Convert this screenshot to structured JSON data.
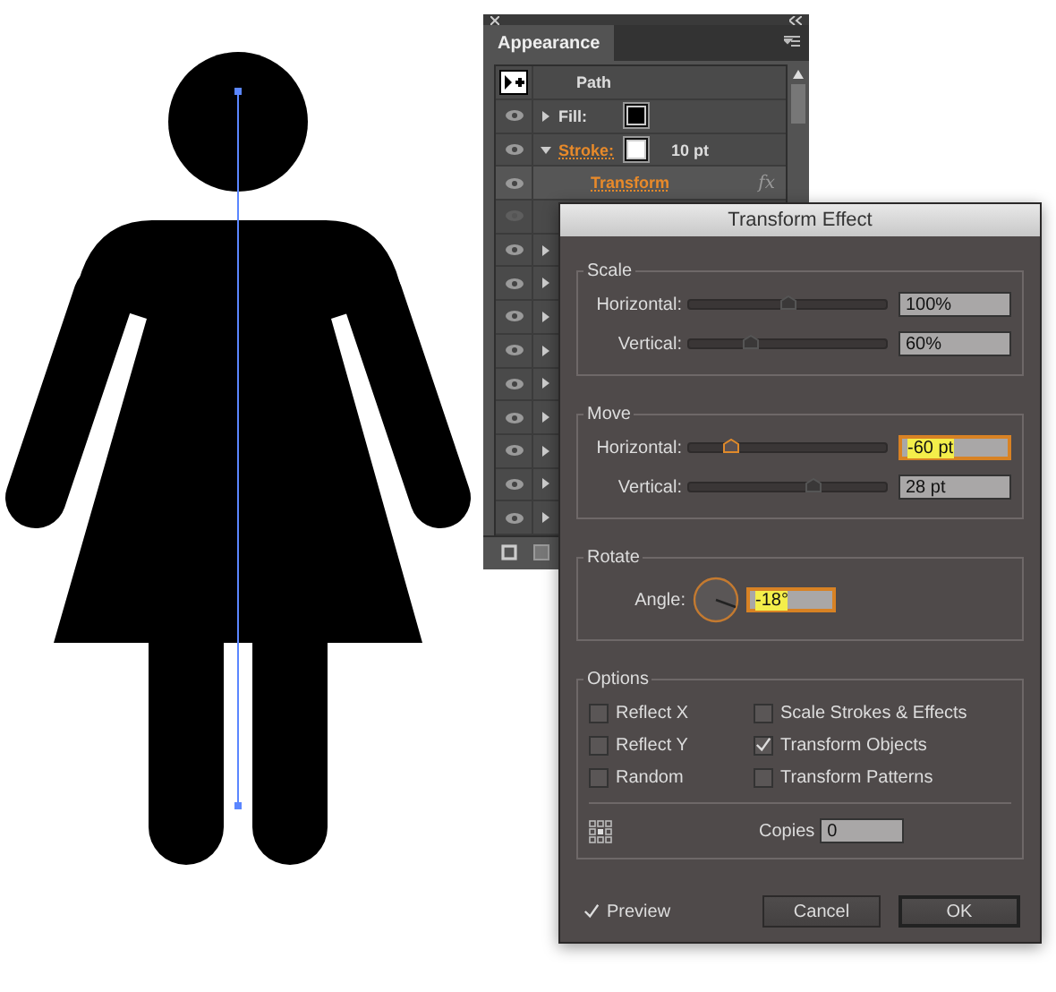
{
  "appearance_panel": {
    "tab": "Appearance",
    "rows": [
      {
        "kind": "object",
        "label": "Path"
      },
      {
        "kind": "attribute",
        "label": "Fill:",
        "color": "#000000",
        "visible": true,
        "expanded": false,
        "highlighted": false
      },
      {
        "kind": "attribute",
        "label": "Stroke:",
        "color": "#ffffff",
        "value": "10 pt",
        "visible": true,
        "expanded": true,
        "highlighted": true
      },
      {
        "kind": "effect",
        "label": "Transform",
        "badge": "fx",
        "visible": true
      },
      {
        "kind": "blank",
        "visible": false
      },
      {
        "kind": "attribute",
        "visible": true,
        "expanded": false
      },
      {
        "kind": "attribute",
        "visible": true,
        "expanded": false
      },
      {
        "kind": "attribute",
        "visible": true,
        "expanded": false
      },
      {
        "kind": "attribute",
        "visible": true,
        "expanded": false
      },
      {
        "kind": "attribute",
        "visible": true,
        "expanded": false
      },
      {
        "kind": "attribute",
        "visible": true,
        "expanded": false
      },
      {
        "kind": "attribute",
        "visible": true,
        "expanded": false
      },
      {
        "kind": "attribute",
        "visible": true,
        "expanded": false
      },
      {
        "kind": "attribute",
        "visible": true,
        "expanded": false
      }
    ]
  },
  "dialog": {
    "title": "Transform Effect",
    "groups": [
      {
        "title": "Scale",
        "sliders": [
          {
            "label": "Horizontal:",
            "level": 0.5,
            "value": "100%",
            "focused": false
          },
          {
            "label": "Vertical:",
            "level": 0.31,
            "value": "60%",
            "focused": false
          }
        ]
      },
      {
        "title": "Move",
        "sliders": [
          {
            "label": "Horizontal:",
            "level": 0.21,
            "value": "-60 pt",
            "focused": true
          },
          {
            "label": "Vertical:",
            "level": 0.63,
            "value": "28 pt",
            "focused": false
          }
        ]
      }
    ],
    "rotate": {
      "title": "Rotate",
      "label": "Angle:",
      "value": "-18°",
      "focused": true
    },
    "options": {
      "title": "Options",
      "checkboxes": [
        {
          "label": "Reflect X",
          "checked": false
        },
        {
          "label": "Reflect Y",
          "checked": false
        },
        {
          "label": "Random",
          "checked": false
        },
        {
          "label": "Scale Strokes & Effects",
          "checked": false
        },
        {
          "label": "Transform Objects",
          "checked": true
        },
        {
          "label": "Transform Patterns",
          "checked": false
        }
      ],
      "copies_label": "Copies",
      "copies_value": "0"
    },
    "preview": {
      "label": "Preview",
      "checked": true
    },
    "buttons": [
      {
        "label": "Cancel",
        "default": false
      },
      {
        "label": "OK",
        "default": true
      }
    ]
  }
}
